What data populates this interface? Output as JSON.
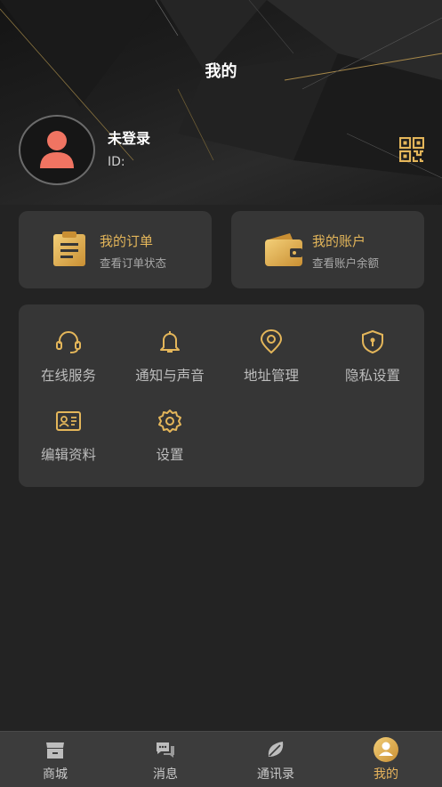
{
  "header": {
    "title": "我的"
  },
  "profile": {
    "name": "未登录",
    "id_label": "ID:"
  },
  "cards": [
    {
      "title": "我的订单",
      "subtitle": "查看订单状态",
      "icon": "clipboard-icon"
    },
    {
      "title": "我的账户",
      "subtitle": "查看账户余额",
      "icon": "wallet-icon"
    }
  ],
  "services": [
    {
      "label": "在线服务",
      "icon": "headset-icon"
    },
    {
      "label": "通知与声音",
      "icon": "bell-icon"
    },
    {
      "label": "地址管理",
      "icon": "location-pin-icon"
    },
    {
      "label": "隐私设置",
      "icon": "shield-lock-icon"
    },
    {
      "label": "编辑资料",
      "icon": "id-card-icon"
    },
    {
      "label": "设置",
      "icon": "gear-icon"
    }
  ],
  "tabs": [
    {
      "label": "商城",
      "icon": "shop-icon",
      "active": false
    },
    {
      "label": "消息",
      "icon": "chat-bubbles-icon",
      "active": false
    },
    {
      "label": "通讯录",
      "icon": "leaf-icon",
      "active": false
    },
    {
      "label": "我的",
      "icon": "user-icon",
      "active": true
    }
  ],
  "colors": {
    "accent": "#e4b65a",
    "background": "#232323",
    "card": "#363636",
    "avatar": "#f07462"
  }
}
